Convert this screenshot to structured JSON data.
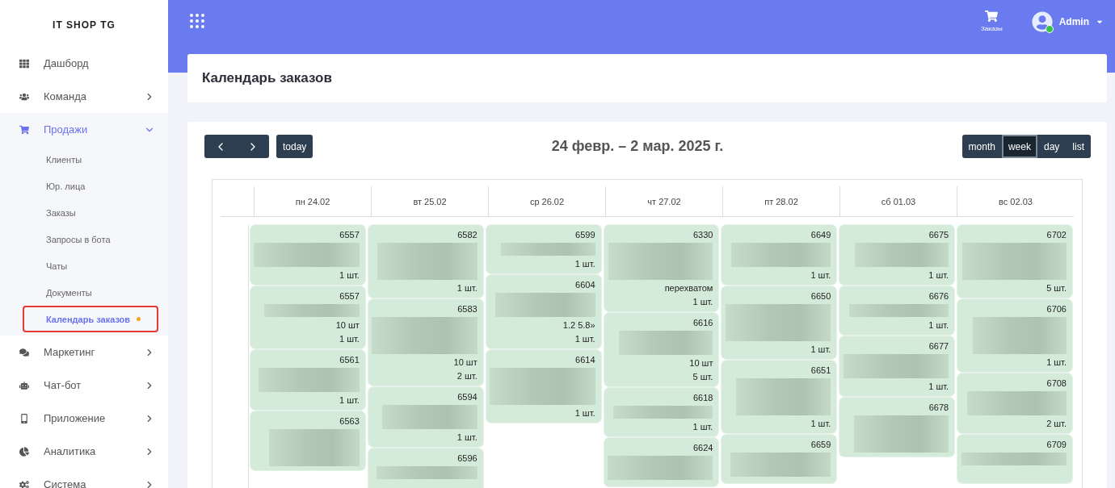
{
  "sidebar": {
    "brand": "IT SHOP TG",
    "items": [
      {
        "label": "Дашборд",
        "has_children": false,
        "selected": false
      },
      {
        "label": "Команда",
        "has_children": true,
        "expanded": false,
        "selected": false
      },
      {
        "label": "Продажи",
        "has_children": true,
        "expanded": true,
        "selected": true,
        "children": [
          {
            "label": "Клиенты",
            "selected": false,
            "dot": false,
            "outlined": false
          },
          {
            "label": "Юр. лица",
            "selected": false,
            "dot": false,
            "outlined": false
          },
          {
            "label": "Заказы",
            "selected": false,
            "dot": false,
            "outlined": false
          },
          {
            "label": "Запросы в бота",
            "selected": false,
            "dot": false,
            "outlined": false
          },
          {
            "label": "Чаты",
            "selected": false,
            "dot": false,
            "outlined": false
          },
          {
            "label": "Документы",
            "selected": false,
            "dot": false,
            "outlined": false
          },
          {
            "label": "Календарь заказов",
            "selected": true,
            "dot": true,
            "outlined": true
          }
        ]
      },
      {
        "label": "Маркетинг",
        "has_children": true,
        "expanded": false,
        "selected": false
      },
      {
        "label": "Чат-бот",
        "has_children": true,
        "expanded": false,
        "selected": false
      },
      {
        "label": "Приложение",
        "has_children": true,
        "expanded": false,
        "selected": false
      },
      {
        "label": "Аналитика",
        "has_children": true,
        "expanded": false,
        "selected": false
      },
      {
        "label": "Система",
        "has_children": true,
        "expanded": false,
        "selected": false
      }
    ]
  },
  "topbar": {
    "orders_label": "Заказы",
    "user": "Admin",
    "online": true
  },
  "page_title": "Календарь заказов",
  "calendar": {
    "today_label": "today",
    "range": "24 февр. – 2 мар. 2025 г.",
    "views": [
      {
        "label": "month",
        "selected": false
      },
      {
        "label": "week",
        "selected": true
      },
      {
        "label": "day",
        "selected": false
      },
      {
        "label": "list",
        "selected": false
      }
    ],
    "days": [
      {
        "label": "пн 24.02",
        "events": [
          {
            "number": "6557",
            "qty": "1 шт."
          },
          {
            "number": "6557",
            "lines": [
              "10 шт"
            ],
            "qty": "1 шт."
          },
          {
            "number": "6561",
            "qty": "1 шт."
          },
          {
            "number": "6563"
          }
        ]
      },
      {
        "label": "вт 25.02",
        "events": [
          {
            "number": "6582",
            "qty": "1 шт."
          },
          {
            "number": "6583",
            "lines": [
              "10 шт"
            ],
            "qty": "2 шт."
          },
          {
            "number": "6594",
            "qty": "1 шт."
          },
          {
            "number": "6596"
          }
        ]
      },
      {
        "label": "ср 26.02",
        "events": [
          {
            "number": "6599",
            "qty": "1 шт."
          },
          {
            "number": "6604",
            "lines": [
              "1.2 5.8»"
            ],
            "qty": "1 шт."
          },
          {
            "number": "6614",
            "qty": "1 шт."
          }
        ]
      },
      {
        "label": "чт 27.02",
        "events": [
          {
            "number": "6330",
            "lines": [
              "перехватом"
            ],
            "qty": "1 шт."
          },
          {
            "number": "6616",
            "lines": [
              "10 шт"
            ],
            "qty": "5 шт."
          },
          {
            "number": "6618",
            "qty": "1 шт."
          },
          {
            "number": "6624"
          }
        ]
      },
      {
        "label": "пт 28.02",
        "events": [
          {
            "number": "6649",
            "qty": "1 шт."
          },
          {
            "number": "6650",
            "qty": "1 шт."
          },
          {
            "number": "6651",
            "qty": "1 шт."
          },
          {
            "number": "6659"
          }
        ]
      },
      {
        "label": "сб 01.03",
        "events": [
          {
            "number": "6675",
            "qty": "1 шт."
          },
          {
            "number": "6676",
            "qty": "1 шт."
          },
          {
            "number": "6677",
            "qty": "1 шт."
          },
          {
            "number": "6678"
          }
        ]
      },
      {
        "label": "вс 02.03",
        "events": [
          {
            "number": "6702",
            "qty": "5 шт."
          },
          {
            "number": "6706",
            "qty": "1 шт."
          },
          {
            "number": "6708",
            "qty": "2 шт."
          },
          {
            "number": "6709"
          }
        ]
      }
    ]
  }
}
